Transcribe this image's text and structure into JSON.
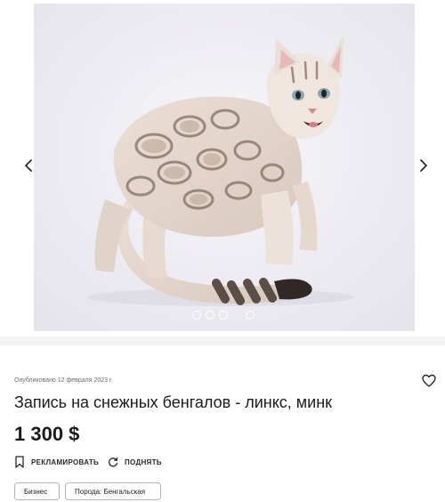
{
  "gallery": {
    "image_alt": "Bengal snow lynx kitten",
    "prev_icon": "chevron-left-icon",
    "next_icon": "chevron-right-icon",
    "expand_icon": "fullscreen-icon",
    "slide_count": 4,
    "active_slide": 1
  },
  "listing": {
    "published": "Опубликовано 12 февраля 2023 г.",
    "title": "Запись на снежных бенгалов - линкс, минк",
    "price": "1 300 $",
    "favorite_icon": "heart-icon"
  },
  "actions": {
    "promote_label": "РЕКЛАМИРОВАТЬ",
    "promote_icon": "bookmark-icon",
    "raise_label": "ПОДНЯТЬ",
    "raise_icon": "refresh-icon"
  },
  "tags": [
    "Бизнес",
    "Порода: Бенгальская"
  ],
  "colors": {
    "text": "#1b1b1b",
    "muted": "#6b6b6b",
    "tag_border": "#b5b5b5",
    "band": "#f3f3f3"
  }
}
